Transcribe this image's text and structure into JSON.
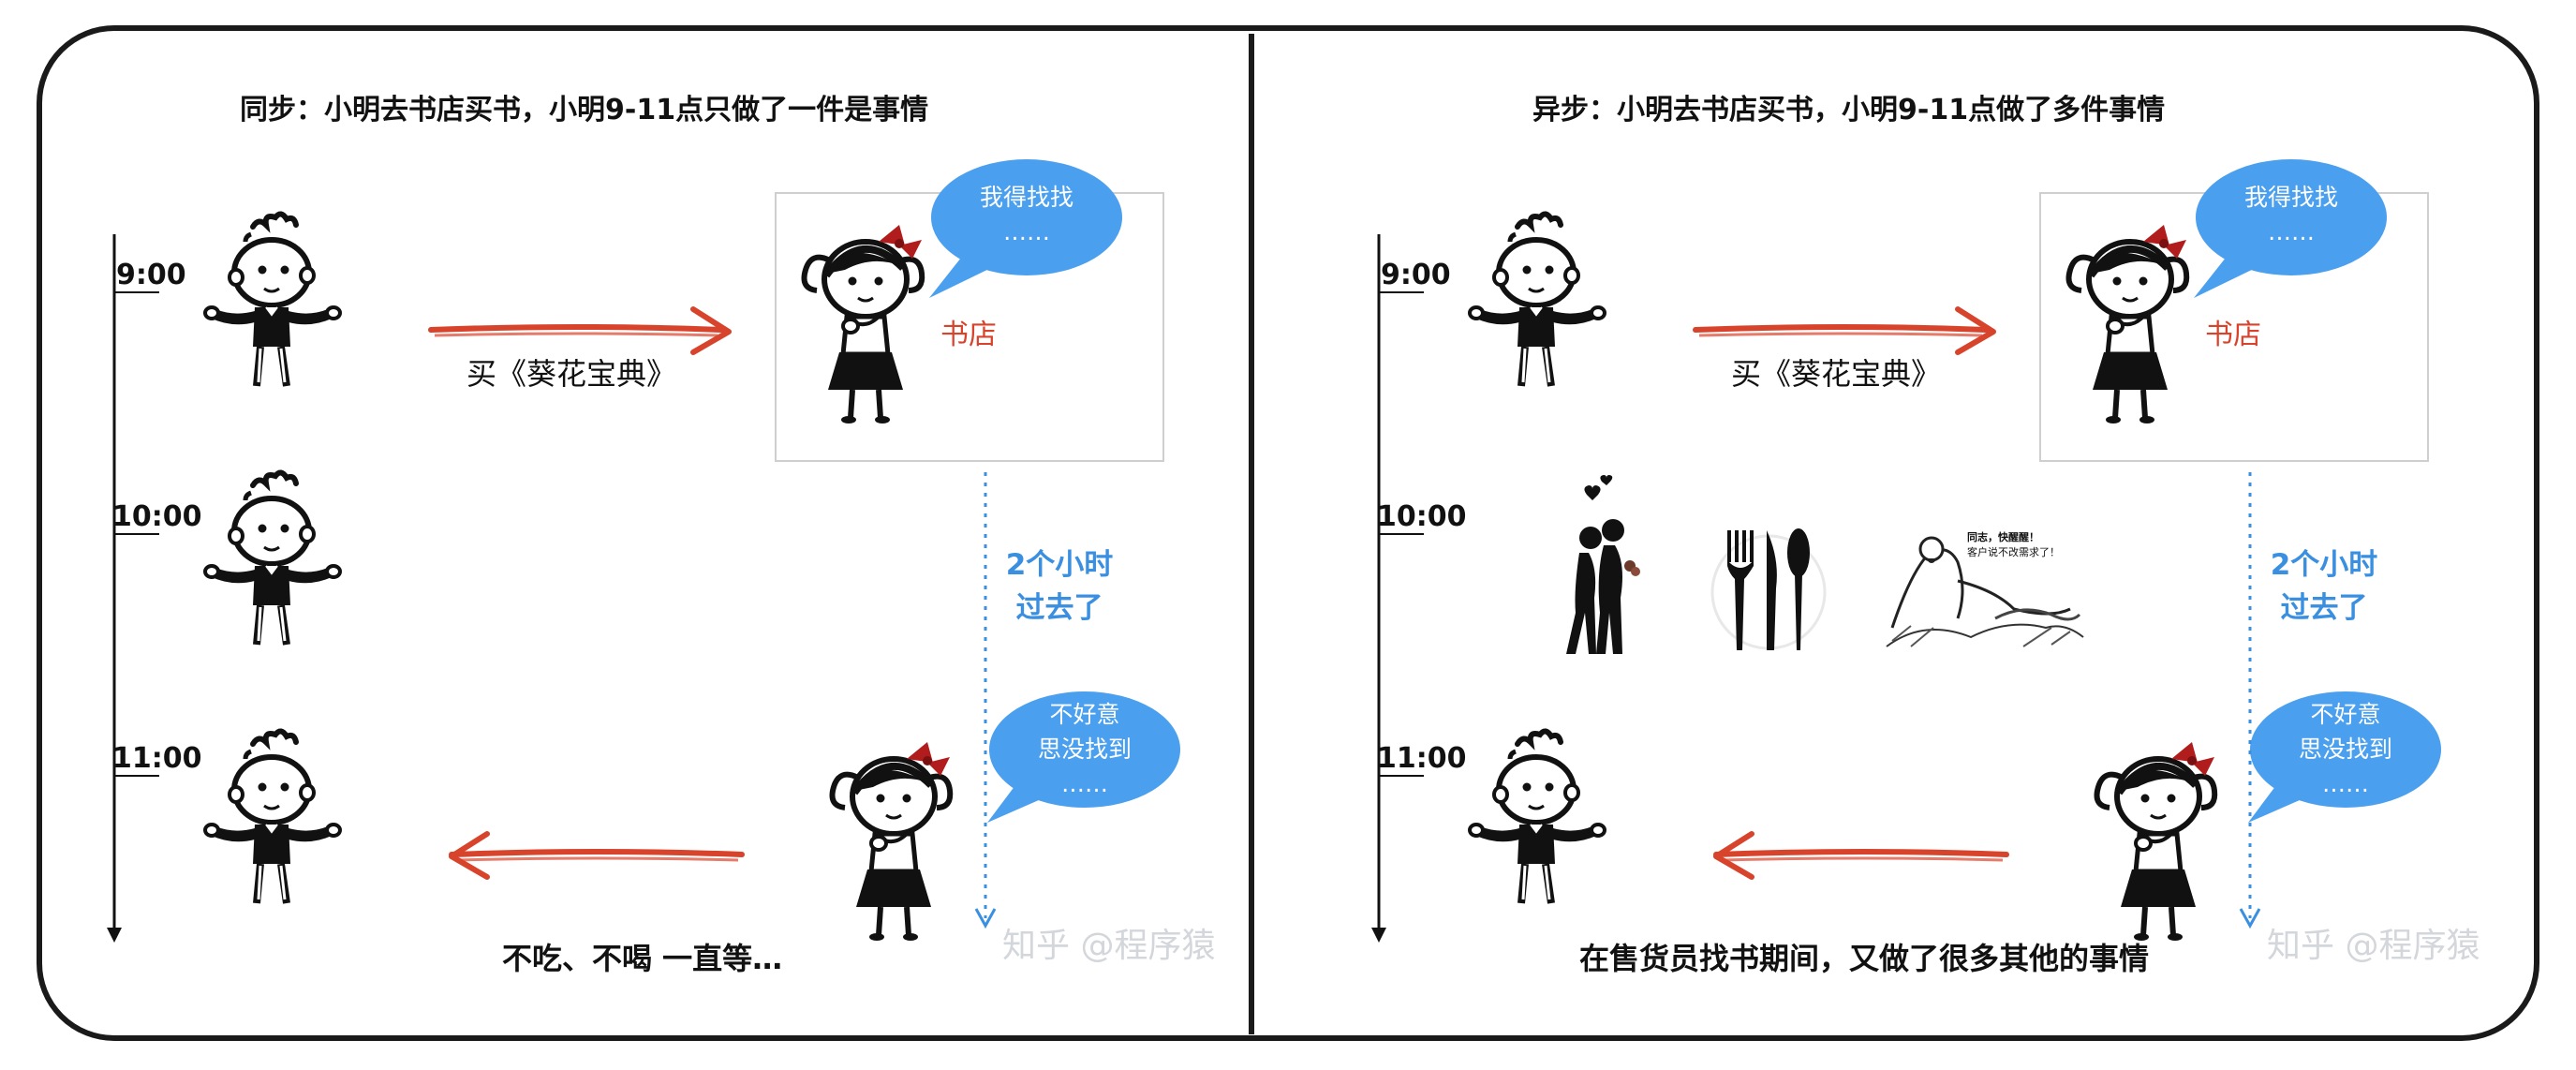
{
  "left": {
    "title": "同步：小明去书店买书，小明9-11点只做了一件是事情",
    "times": [
      "9:00",
      "10:00",
      "11:00"
    ],
    "buy_label": "买《葵花宝典》",
    "shop_label": "书店",
    "bubble_search": [
      "我得找找",
      "……"
    ],
    "elapsed": [
      "2个小时",
      "过去了"
    ],
    "bubble_sorry": [
      "不好意",
      "思没找到",
      "……"
    ],
    "bottom_caption": "不吃、不喝 一直等…",
    "watermark": "知乎 @程序猿"
  },
  "right": {
    "title": "异步：小明去书店买书，小明9-11点做了多件事情",
    "times": [
      "9:00",
      "10:00",
      "11:00"
    ],
    "buy_label": "买《葵花宝典》",
    "shop_label": "书店",
    "bubble_search": [
      "我得找找",
      "……"
    ],
    "elapsed": [
      "2个小时",
      "过去了"
    ],
    "bubble_sorry": [
      "不好意",
      "思没找到",
      "……"
    ],
    "activity_icons": [
      "couple-silhouette-icon",
      "cutlery-icon",
      "meme-sketch"
    ],
    "meme_caption": [
      "同志，快醒醒！",
      "客户说不改需求了！"
    ],
    "bottom_caption": "在售货员找书期间，又做了很多其他的事情",
    "watermark": "知乎 @程序猿"
  },
  "colors": {
    "frame": "#1a1a1a",
    "arrow_red": "#d8432c",
    "bubble_blue": "#4a9fee",
    "dotted_blue": "#3a8fe0",
    "text": "#111111",
    "watermark": "#d3d6da"
  }
}
